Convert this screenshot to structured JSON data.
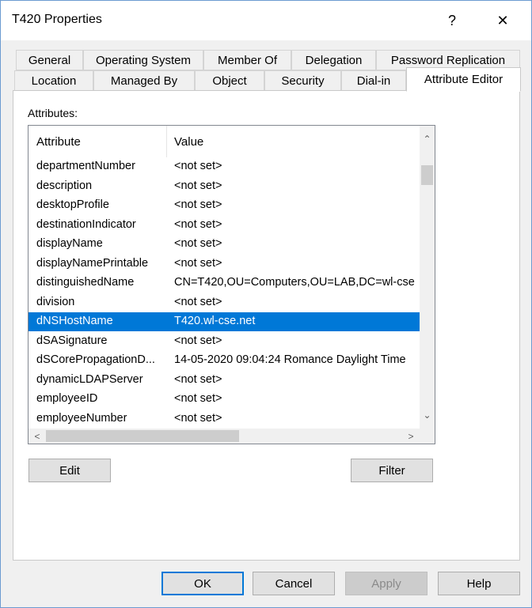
{
  "window": {
    "title": "T420 Properties",
    "help_glyph": "?",
    "close_glyph": "✕"
  },
  "tabs": {
    "row1": [
      "General",
      "Operating System",
      "Member Of",
      "Delegation",
      "Password Replication"
    ],
    "row2": [
      "Location",
      "Managed By",
      "Object",
      "Security",
      "Dial-in",
      "Attribute Editor"
    ],
    "active": "Attribute Editor"
  },
  "attributes": {
    "label": "Attributes:",
    "columns": {
      "attribute": "Attribute",
      "value": "Value"
    },
    "rows": [
      {
        "attribute": "departmentNumber",
        "value": "<not set>"
      },
      {
        "attribute": "description",
        "value": "<not set>"
      },
      {
        "attribute": "desktopProfile",
        "value": "<not set>"
      },
      {
        "attribute": "destinationIndicator",
        "value": "<not set>"
      },
      {
        "attribute": "displayName",
        "value": "<not set>"
      },
      {
        "attribute": "displayNamePrintable",
        "value": "<not set>"
      },
      {
        "attribute": "distinguishedName",
        "value": "CN=T420,OU=Computers,OU=LAB,DC=wl-cse"
      },
      {
        "attribute": "division",
        "value": "<not set>"
      },
      {
        "attribute": "dNSHostName",
        "value": "T420.wl-cse.net",
        "selected": true
      },
      {
        "attribute": "dSASignature",
        "value": "<not set>"
      },
      {
        "attribute": "dSCorePropagationD...",
        "value": "14-05-2020 09:04:24 Romance Daylight Time"
      },
      {
        "attribute": "dynamicLDAPServer",
        "value": "<not set>"
      },
      {
        "attribute": "employeeID",
        "value": "<not set>"
      },
      {
        "attribute": "employeeNumber",
        "value": "<not set>"
      }
    ],
    "scroll": {
      "up": "⌃",
      "down": "⌄",
      "left": "<",
      "right": ">"
    }
  },
  "buttons": {
    "edit": "Edit",
    "filter": "Filter",
    "ok": "OK",
    "cancel": "Cancel",
    "apply": "Apply",
    "help": "Help"
  },
  "colors": {
    "selection": "#0078d7",
    "window_border": "#6b9bd1"
  }
}
